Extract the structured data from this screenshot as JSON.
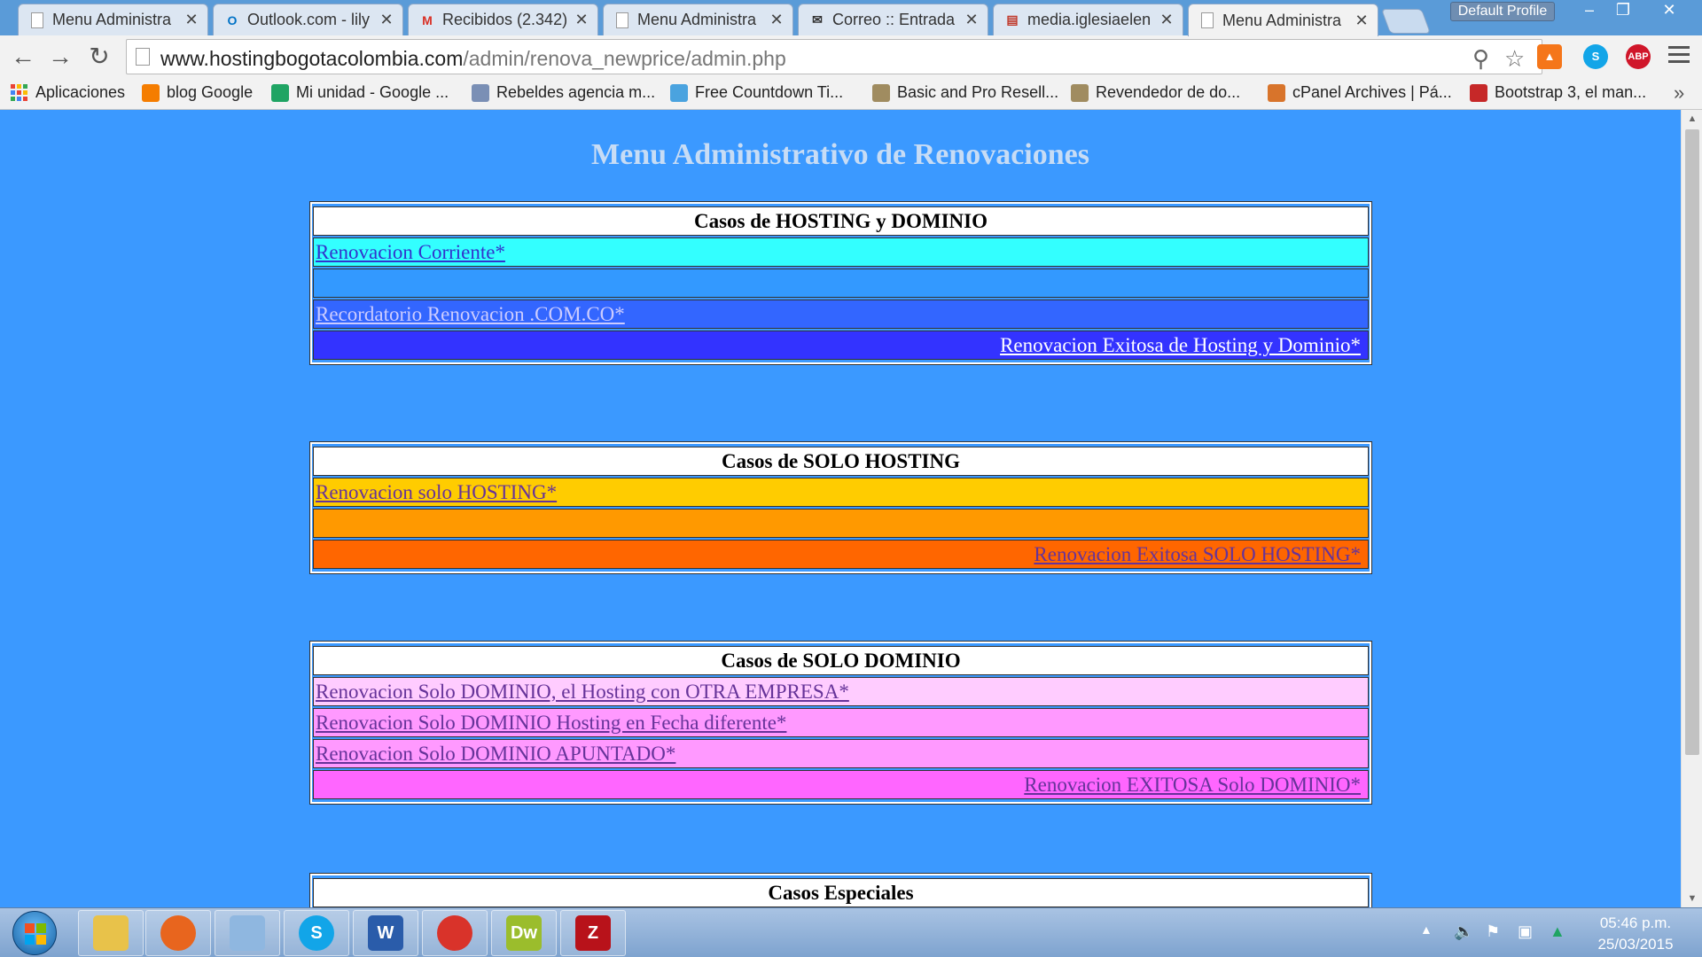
{
  "browser": {
    "tabs": [
      {
        "label": "Menu Administra",
        "icon": "page-icon"
      },
      {
        "label": "Outlook.com - lily",
        "icon": "outlook-icon"
      },
      {
        "label": "Recibidos (2.342)",
        "icon": "gmail-icon"
      },
      {
        "label": "Menu Administra",
        "icon": "page-icon"
      },
      {
        "label": "Correo :: Entrada",
        "icon": "mail-icon"
      },
      {
        "label": "media.iglesiaelen",
        "icon": "media-icon"
      },
      {
        "label": "Menu Administra",
        "icon": "page-icon",
        "active": true
      }
    ],
    "profile_label": "Default Profile",
    "url_domain": "www.hostingbogotacolombia.com",
    "url_path": "/admin/renova_newprice/admin.php",
    "ext_abp": "ABP",
    "ext_skype": "S",
    "bookmarks": [
      {
        "label": "Aplicaciones",
        "icon": "apps-icon"
      },
      {
        "label": "blog Google",
        "icon": "blogger-icon"
      },
      {
        "label": "Mi unidad - Google ...",
        "icon": "drive-icon"
      },
      {
        "label": "Rebeldes agencia m...",
        "icon": "rebeldes-icon"
      },
      {
        "label": "Free Countdown Ti...",
        "icon": "countdown-icon"
      },
      {
        "label": "Basic and Pro Resell...",
        "icon": "reseller-icon"
      },
      {
        "label": "Revendedor de do...",
        "icon": "reseller-icon"
      },
      {
        "label": "cPanel Archives | Pá...",
        "icon": "cpanel-icon"
      },
      {
        "label": "Bootstrap 3, el man...",
        "icon": "book-icon"
      }
    ],
    "bookmarks_more": "»"
  },
  "page": {
    "title": "Menu Administrativo de Renovaciones",
    "sections": [
      {
        "header": "Casos de HOSTING y DOMINIO",
        "rows": [
          {
            "label": "Renovacion Corriente*",
            "bg": "#33ffff",
            "color": "#3333cc",
            "align": "left"
          },
          {
            "label": "",
            "bg": "#3399ff",
            "color": "#000000",
            "align": "left"
          },
          {
            "label": "Recordatorio Renovacion .COM.CO*",
            "bg": "#3366ff",
            "color": "#ccccff",
            "align": "left"
          },
          {
            "label": "Renovacion Exitosa de Hosting y Dominio*",
            "bg": "#3333ff",
            "color": "#ffffff",
            "align": "right"
          }
        ]
      },
      {
        "header": "Casos de SOLO HOSTING",
        "rows": [
          {
            "label": "Renovacion solo HOSTING*",
            "bg": "#ffcc00",
            "color": "#663399",
            "align": "left"
          },
          {
            "label": "",
            "bg": "#ff9900",
            "color": "#000000",
            "align": "left"
          },
          {
            "label": "Renovacion Exitosa SOLO HOSTING*",
            "bg": "#ff6600",
            "color": "#663399",
            "align": "right"
          }
        ]
      },
      {
        "header": "Casos de SOLO DOMINIO",
        "rows": [
          {
            "label": "Renovacion Solo DOMINIO, el Hosting con OTRA EMPRESA*",
            "bg": "#ffccff",
            "color": "#663399",
            "align": "left"
          },
          {
            "label": "Renovacion Solo DOMINIO Hosting en Fecha diferente*",
            "bg": "#ff99ff",
            "color": "#663399",
            "align": "left"
          },
          {
            "label": "Renovacion Solo DOMINIO APUNTADO*",
            "bg": "#ff99ff",
            "color": "#663399",
            "align": "left"
          },
          {
            "label": "Renovacion EXITOSA Solo DOMINIO*",
            "bg": "#ff66ff",
            "color": "#663399",
            "align": "right"
          }
        ]
      },
      {
        "header": "Casos Especiales",
        "rows": []
      }
    ]
  },
  "taskbar": {
    "apps": [
      {
        "name": "explorer",
        "icon": "folder-icon",
        "color": "#e8c24a",
        "glyph": ""
      },
      {
        "name": "firefox",
        "icon": "firefox-icon",
        "color": "#e8651e",
        "glyph": ""
      },
      {
        "name": "paint",
        "icon": "paint-icon",
        "color": "#8fb7e0",
        "glyph": ""
      },
      {
        "name": "skype",
        "icon": "skype-icon",
        "color": "#12a5e8",
        "glyph": "S"
      },
      {
        "name": "word",
        "icon": "word-icon",
        "color": "#2a5caa",
        "glyph": "W"
      },
      {
        "name": "chrome",
        "icon": "chrome-icon",
        "color": "#d9332a",
        "glyph": ""
      },
      {
        "name": "dreamweaver",
        "icon": "dreamweaver-icon",
        "color": "#9bbd2c",
        "glyph": "Dw"
      },
      {
        "name": "filezilla",
        "icon": "filezilla-icon",
        "color": "#b8121a",
        "glyph": "Z"
      }
    ],
    "time": "05:46 p.m.",
    "date": "25/03/2015"
  }
}
